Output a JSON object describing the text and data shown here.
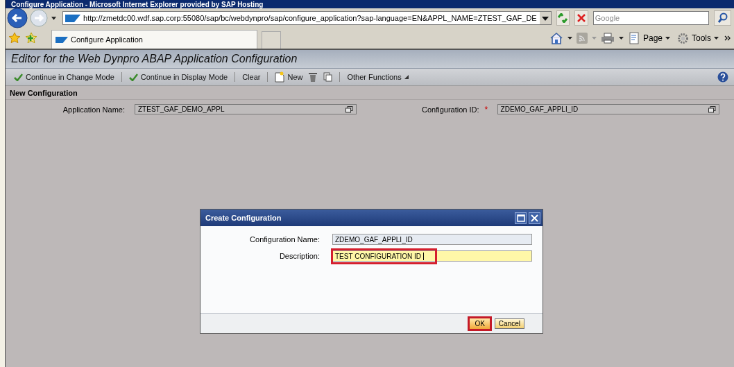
{
  "window": {
    "title": "Configure Application - Microsoft Internet Explorer provided by SAP Hosting"
  },
  "address_bar": {
    "url": "http://zmetdc00.wdf.sap.corp:55080/sap/bc/webdynpro/sap/configure_application?sap-language=EN&APPL_NAME=ZTEST_GAF_DE"
  },
  "search": {
    "placeholder": "Google"
  },
  "tab": {
    "label": "Configure Application"
  },
  "command_bar": [
    "Page",
    "Tools"
  ],
  "page": {
    "title": "Editor for the Web Dynpro ABAP Application Configuration",
    "toolbar": [
      {
        "kind": "check",
        "label": "Continue in Change Mode"
      },
      {
        "kind": "check",
        "label": "Continue in Display Mode"
      },
      {
        "kind": "text",
        "label": "Clear"
      },
      {
        "kind": "new",
        "label": "New"
      },
      {
        "kind": "trash"
      },
      {
        "kind": "copy"
      },
      {
        "kind": "menu",
        "label": "Other Functions"
      }
    ],
    "section": "New Configuration",
    "fields": [
      {
        "label": "Application Name:",
        "value": "ZTEST_GAF_DEMO_APPL"
      },
      {
        "label": "Configuration ID:",
        "required_mark": "*",
        "value": "ZDEMO_GAF_APPLI_ID"
      }
    ]
  },
  "dialog": {
    "title": "Create Configuration",
    "fields": [
      {
        "label": "Configuration Name:",
        "value": "ZDEMO_GAF_APPLI_ID",
        "readonly": true,
        "highlighted": false
      },
      {
        "label": "Description:",
        "value": "TEST CONFIGURATION ID",
        "readonly": false,
        "highlighted": true
      }
    ],
    "buttons": [
      {
        "label": "OK",
        "highlighted": true
      },
      {
        "label": "Cancel",
        "highlighted": false
      }
    ]
  }
}
